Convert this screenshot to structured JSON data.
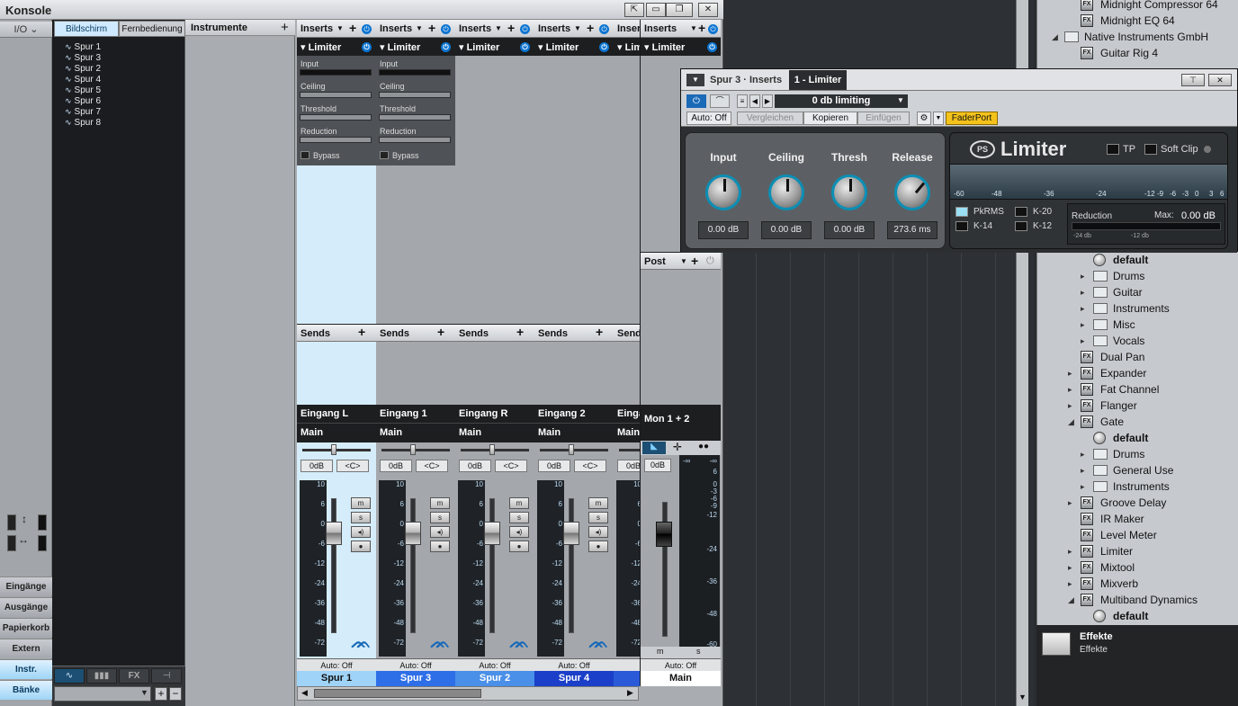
{
  "konsole": {
    "title": "Konsole",
    "io_label": "I/O",
    "nav_tabs": [
      "Bildschirm",
      "Fernbedienung"
    ],
    "spur_list": [
      "Spur 1",
      "Spur 3",
      "Spur 2",
      "Spur 4",
      "Spur 5",
      "Spur 6",
      "Spur 7",
      "Spur 8"
    ],
    "left_buttons": [
      "Eingänge",
      "Ausgänge",
      "Papierkorb",
      "Extern",
      "Instr.",
      "Bänke"
    ],
    "instrumente_label": "Instrumente",
    "nav_bottom_fx": "FX"
  },
  "channels": [
    {
      "inserts": "Inserts",
      "plugin": "Limiter",
      "params": [
        "Input",
        "Ceiling",
        "Threshold",
        "Reduction"
      ],
      "bypass": "Bypass",
      "sends": "Sends",
      "input": "Eingang L",
      "output": "Main",
      "db": "0dB",
      "pan": "<C>",
      "auto": "Auto: Off",
      "name": "Spur 1",
      "name_bg": "#9fd3f8",
      "selected": true
    },
    {
      "inserts": "Inserts",
      "plugin": "Limiter",
      "params": [
        "Input",
        "Ceiling",
        "Threshold",
        "Reduction"
      ],
      "bypass": "Bypass",
      "sends": "Sends",
      "input": "Eingang 1",
      "output": "Main",
      "db": "0dB",
      "pan": "<C>",
      "auto": "Auto: Off",
      "name": "Spur 3",
      "name_bg": "#2e6fe8",
      "selected": false
    },
    {
      "inserts": "Inserts",
      "plugin": "Limiter",
      "params": [],
      "bypass": "",
      "sends": "Sends",
      "input": "Eingang R",
      "output": "Main",
      "db": "0dB",
      "pan": "<C>",
      "auto": "Auto: Off",
      "name": "Spur 2",
      "name_bg": "#4a8fe8",
      "selected": false
    },
    {
      "inserts": "Inserts",
      "plugin": "Limiter",
      "params": [],
      "bypass": "",
      "sends": "Sends",
      "input": "Eingang 2",
      "output": "Main",
      "db": "0dB",
      "pan": "<C>",
      "auto": "Auto: Off",
      "name": "Spur 4",
      "name_bg": "#1b3fc8",
      "selected": false
    },
    {
      "inserts": "Inser",
      "plugin": "Limi",
      "params": [],
      "bypass": "",
      "sends": "Send",
      "input": "Einga",
      "output": "Main",
      "db": "0dB",
      "pan": "<C>",
      "auto": "A",
      "name": "S",
      "name_bg": "#2a5ad8",
      "selected": false
    }
  ],
  "fader_scale": [
    "10",
    "6",
    "0",
    "-6",
    "-12",
    "-24",
    "-36",
    "-48",
    "-72"
  ],
  "mute_solo": [
    "m",
    "s"
  ],
  "monitor": {
    "inserts": "Inserts",
    "plugin": "Limiter",
    "post": "Post",
    "input": "Mon 1 + 2",
    "db": "0dB",
    "auto": "Auto: Off",
    "name": "Main",
    "scale": [
      "-∞",
      "6",
      "0",
      "-3",
      "-6",
      "-9",
      "-12",
      "-24",
      "-36",
      "-48",
      "-60"
    ],
    "meter_top": "-∞"
  },
  "plugin_window": {
    "track": "Spur 3 · Inserts",
    "plugin_tab": "1 - Limiter",
    "preset": "0 db limiting",
    "auto": "Auto: Off",
    "compare": "Vergleichen",
    "copy": "Kopieren",
    "paste": "Einfügen",
    "faderport": "FaderPort",
    "knobs": [
      {
        "label": "Input",
        "value": "0.00 dB"
      },
      {
        "label": "Ceiling",
        "value": "0.00 dB"
      },
      {
        "label": "Thresh",
        "value": "0.00 dB"
      },
      {
        "label": "Release",
        "value": "273.6 ms"
      }
    ],
    "brand": "Limiter",
    "tp": "TP",
    "soft_clip": "Soft Clip",
    "meter_scale": [
      "-60",
      "-48",
      "-36",
      "-24",
      "-12",
      "-9",
      "-6",
      "-3",
      "0",
      "3",
      "6"
    ],
    "modes": [
      "PkRMS",
      "K-20",
      "K-14",
      "K-12"
    ],
    "reduction": "Reduction",
    "max_label": "Max:",
    "max_value": "0.00 dB",
    "red_scale": [
      "-24 db",
      "-12 db"
    ]
  },
  "browser": {
    "items": [
      {
        "label": "Midnight Compressor 64",
        "type": "fx",
        "indent": 1
      },
      {
        "label": "Midnight EQ 64",
        "type": "fx",
        "indent": 1
      },
      {
        "label": "Native Instruments GmbH",
        "type": "folder",
        "indent": 0,
        "arrow": "◢"
      },
      {
        "label": "Guitar Rig 4",
        "type": "fx",
        "indent": 1
      },
      {
        "label": "default",
        "type": "preset",
        "indent": 2
      },
      {
        "label": "Drums",
        "type": "folder",
        "indent": 2,
        "arrow": "▸"
      },
      {
        "label": "Guitar",
        "type": "folder",
        "indent": 2,
        "arrow": "▸"
      },
      {
        "label": "Instruments",
        "type": "folder",
        "indent": 2,
        "arrow": "▸"
      },
      {
        "label": "Misc",
        "type": "folder",
        "indent": 2,
        "arrow": "▸"
      },
      {
        "label": "Vocals",
        "type": "folder",
        "indent": 2,
        "arrow": "▸"
      },
      {
        "label": "Dual Pan",
        "type": "fx",
        "indent": 1
      },
      {
        "label": "Expander",
        "type": "fx",
        "indent": 1,
        "arrow": "▸"
      },
      {
        "label": "Fat Channel",
        "type": "fx",
        "indent": 1,
        "arrow": "▸"
      },
      {
        "label": "Flanger",
        "type": "fx",
        "indent": 1,
        "arrow": "▸"
      },
      {
        "label": "Gate",
        "type": "fx",
        "indent": 1,
        "arrow": "◢"
      },
      {
        "label": "default",
        "type": "preset",
        "indent": 2
      },
      {
        "label": "Drums",
        "type": "folder",
        "indent": 2,
        "arrow": "▸"
      },
      {
        "label": "General Use",
        "type": "folder",
        "indent": 2,
        "arrow": "▸"
      },
      {
        "label": "Instruments",
        "type": "folder",
        "indent": 2,
        "arrow": "▸"
      },
      {
        "label": "Groove Delay",
        "type": "fx",
        "indent": 1,
        "arrow": "▸"
      },
      {
        "label": "IR Maker",
        "type": "fx",
        "indent": 1
      },
      {
        "label": "Level Meter",
        "type": "fx",
        "indent": 1
      },
      {
        "label": "Limiter",
        "type": "fx",
        "indent": 1,
        "arrow": "▸"
      },
      {
        "label": "Mixtool",
        "type": "fx",
        "indent": 1,
        "arrow": "▸"
      },
      {
        "label": "Mixverb",
        "type": "fx",
        "indent": 1,
        "arrow": "▸"
      },
      {
        "label": "Multiband Dynamics",
        "type": "fx",
        "indent": 1,
        "arrow": "◢"
      },
      {
        "label": "default",
        "type": "preset",
        "indent": 2
      }
    ],
    "footer_title": "Effekte",
    "footer_sub": "Effekte"
  }
}
